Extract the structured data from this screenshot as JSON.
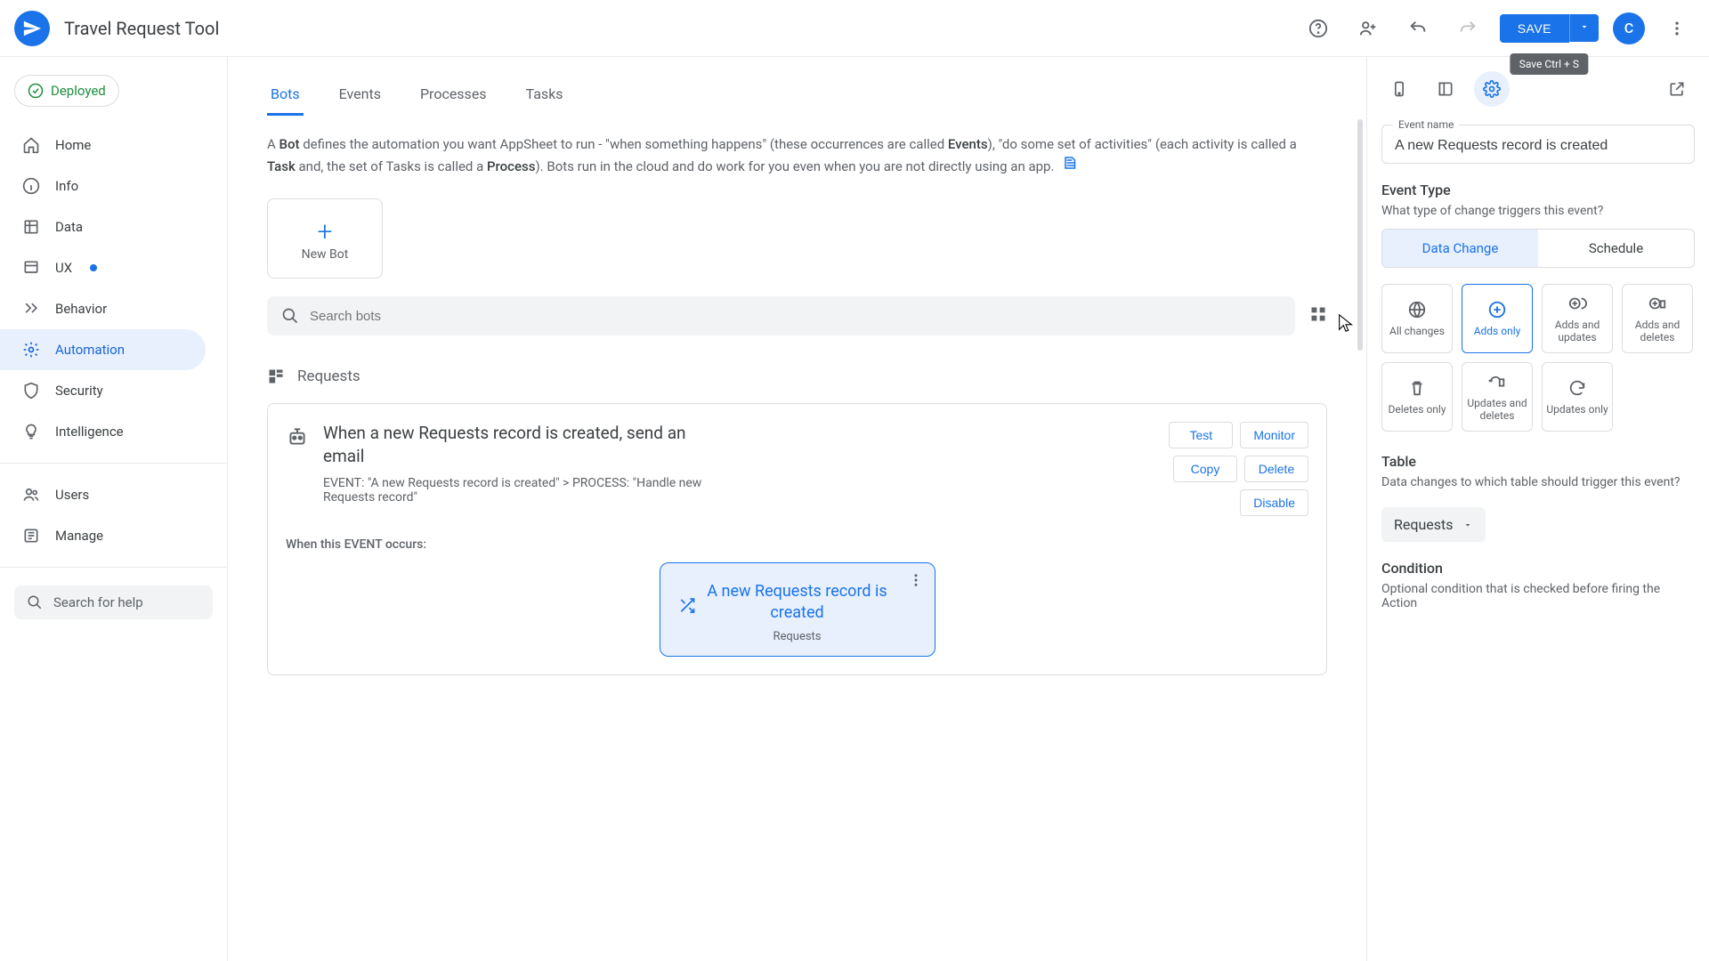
{
  "header": {
    "app_title": "Travel Request Tool",
    "save_label": "SAVE",
    "tooltip": "Save Ctrl + S",
    "avatar_initial": "C"
  },
  "sidebar": {
    "deploy_status": "Deployed",
    "items": [
      {
        "label": "Home"
      },
      {
        "label": "Info"
      },
      {
        "label": "Data"
      },
      {
        "label": "UX"
      },
      {
        "label": "Behavior"
      },
      {
        "label": "Automation"
      },
      {
        "label": "Security"
      },
      {
        "label": "Intelligence"
      }
    ],
    "users_label": "Users",
    "manage_label": "Manage",
    "search_placeholder": "Search for help"
  },
  "tabs": [
    "Bots",
    "Events",
    "Processes",
    "Tasks"
  ],
  "description": {
    "part1": "A ",
    "bot": "Bot",
    "part2": " defines the automation you want AppSheet to run - \"when something happens\" (these occurrences are called ",
    "events": "Events",
    "part3": "), \"do some set of activities\" (each activity is called a ",
    "task": "Task",
    "part4": " and, the set of Tasks is called a ",
    "process": "Process",
    "part5": "). Bots run in the cloud and do work for you even when you are not directly using an app."
  },
  "new_bot_label": "New Bot",
  "search_bots_placeholder": "Search bots",
  "requests_section": "Requests",
  "bot": {
    "title": "When a new Requests record is created, send an email",
    "meta": "EVENT: \"A new Requests record is created\" > PROCESS: \"Handle new Requests record\"",
    "actions": {
      "test": "Test",
      "monitor": "Monitor",
      "copy": "Copy",
      "delete": "Delete",
      "disable": "Disable"
    },
    "event_label": "When this EVENT occurs:",
    "event_card_title": "A new Requests record is created",
    "event_card_sub": "Requests"
  },
  "rpanel": {
    "event_name_label": "Event name",
    "event_name_value": "A new Requests record is created",
    "event_type_title": "Event Type",
    "event_type_sub": "What type of change triggers this event?",
    "seg": {
      "data_change": "Data Change",
      "schedule": "Schedule"
    },
    "changes": {
      "all": "All changes",
      "adds_only": "Adds only",
      "adds_updates": "Adds and updates",
      "adds_deletes": "Adds and deletes",
      "deletes_only": "Deletes only",
      "updates_deletes": "Updates and deletes",
      "updates_only": "Updates only"
    },
    "table_title": "Table",
    "table_sub": "Data changes to which table should trigger this event?",
    "table_value": "Requests",
    "condition_title": "Condition",
    "condition_sub": "Optional condition that is checked before firing the Action"
  }
}
